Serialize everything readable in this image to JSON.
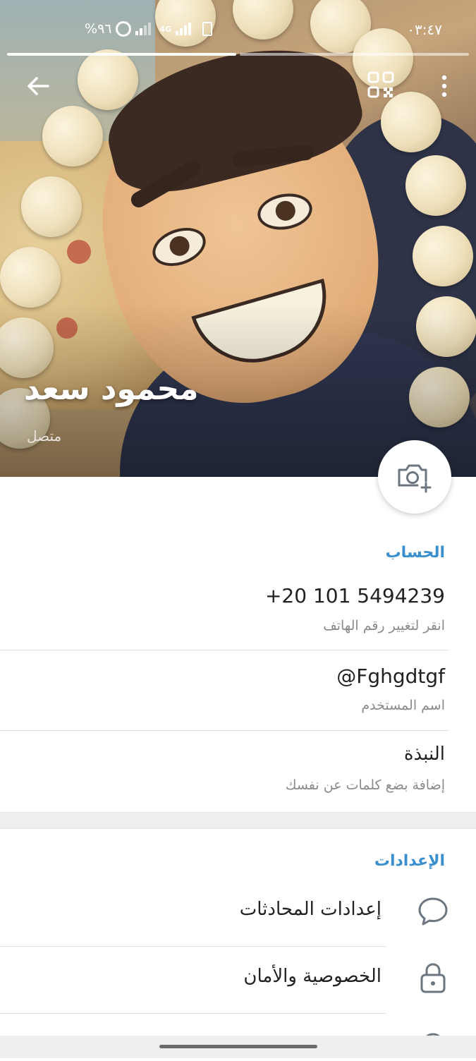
{
  "status_bar": {
    "time": "٠٣:٤٧",
    "battery": "%٩٦",
    "network": "4G"
  },
  "profile": {
    "name": "محمود سعد",
    "presence": "متصل"
  },
  "account": {
    "title": "الحساب",
    "phone": "+20 101 5494239",
    "phone_hint": "انقر لتغيير رقم الهاتف",
    "username": "@Fghgdtgf",
    "username_label": "اسم المستخدم",
    "bio_title": "النبذة",
    "bio_hint": "إضافة بضع كلمات عن نفسك"
  },
  "settings": {
    "title": "الإعدادات",
    "items": [
      {
        "label": "إعدادات المحادثات",
        "icon": "chat-bubble-icon"
      },
      {
        "label": "الخصوصية والأمان",
        "icon": "lock-icon"
      }
    ]
  },
  "colors": {
    "accent": "#3a8fcf",
    "primary_text": "#222222",
    "secondary_text": "#8a8a8a"
  }
}
